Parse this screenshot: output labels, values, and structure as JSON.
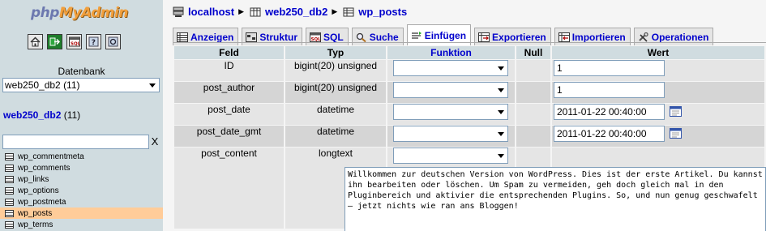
{
  "sidebar": {
    "logo_php": "php",
    "logo_rest": "MyAdmin",
    "icons": [
      "home-icon",
      "exit-icon",
      "sql-query-icon",
      "help-icon",
      "docs-icon"
    ],
    "db_label": "Datenbank",
    "db_select_value": "web250_db2 (11)",
    "db_link_name": "web250_db2",
    "db_link_count": " (11)",
    "filter_value": "",
    "filter_clear": "X",
    "tables": [
      "wp_commentmeta",
      "wp_comments",
      "wp_links",
      "wp_options",
      "wp_postmeta",
      "wp_posts",
      "wp_terms"
    ],
    "active_table": "wp_posts"
  },
  "breadcrumb": {
    "server": "localhost",
    "database": "web250_db2",
    "table": "wp_posts",
    "separator": "▶"
  },
  "tabs": [
    {
      "label": "Anzeigen",
      "icon": "browse-icon"
    },
    {
      "label": "Struktur",
      "icon": "structure-icon"
    },
    {
      "label": "SQL",
      "icon": "sql-icon"
    },
    {
      "label": "Suche",
      "icon": "search-icon"
    },
    {
      "label": "Einfügen",
      "icon": "insert-icon",
      "active": true
    },
    {
      "label": "Exportieren",
      "icon": "export-icon"
    },
    {
      "label": "Importieren",
      "icon": "import-icon"
    },
    {
      "label": "Operationen",
      "icon": "operations-icon"
    }
  ],
  "insert_table": {
    "headers": {
      "field": "Feld",
      "type": "Typ",
      "function": "Funktion",
      "null": "Null",
      "value": "Wert"
    },
    "rows": [
      {
        "field": "ID",
        "type": "bigint(20) unsigned",
        "value": "1"
      },
      {
        "field": "post_author",
        "type": "bigint(20) unsigned",
        "value": "1"
      },
      {
        "field": "post_date",
        "type": "datetime",
        "value": "2011-01-22 00:40:00"
      },
      {
        "field": "post_date_gmt",
        "type": "datetime",
        "value": "2011-01-22 00:40:00"
      },
      {
        "field": "post_content",
        "type": "longtext",
        "value": ""
      }
    ],
    "post_content_text": "Willkommen zur deutschen Version von WordPress. Dies ist der erste Artikel. Du kannst ihn bearbeiten oder löschen. Um Spam zu vermeiden, geh doch gleich mal in den Pluginbereich und aktivier die entsprechenden Plugins. So, und nun genug geschwafelt – jetzt nichts wie ran ans Bloggen!"
  },
  "colors": {
    "nav_bg": "#d0dce0",
    "link_blue": "#0000cc",
    "active_row": "#ffcc99",
    "row_light": "#e5e5e5",
    "row_dark": "#d5d5d5"
  }
}
